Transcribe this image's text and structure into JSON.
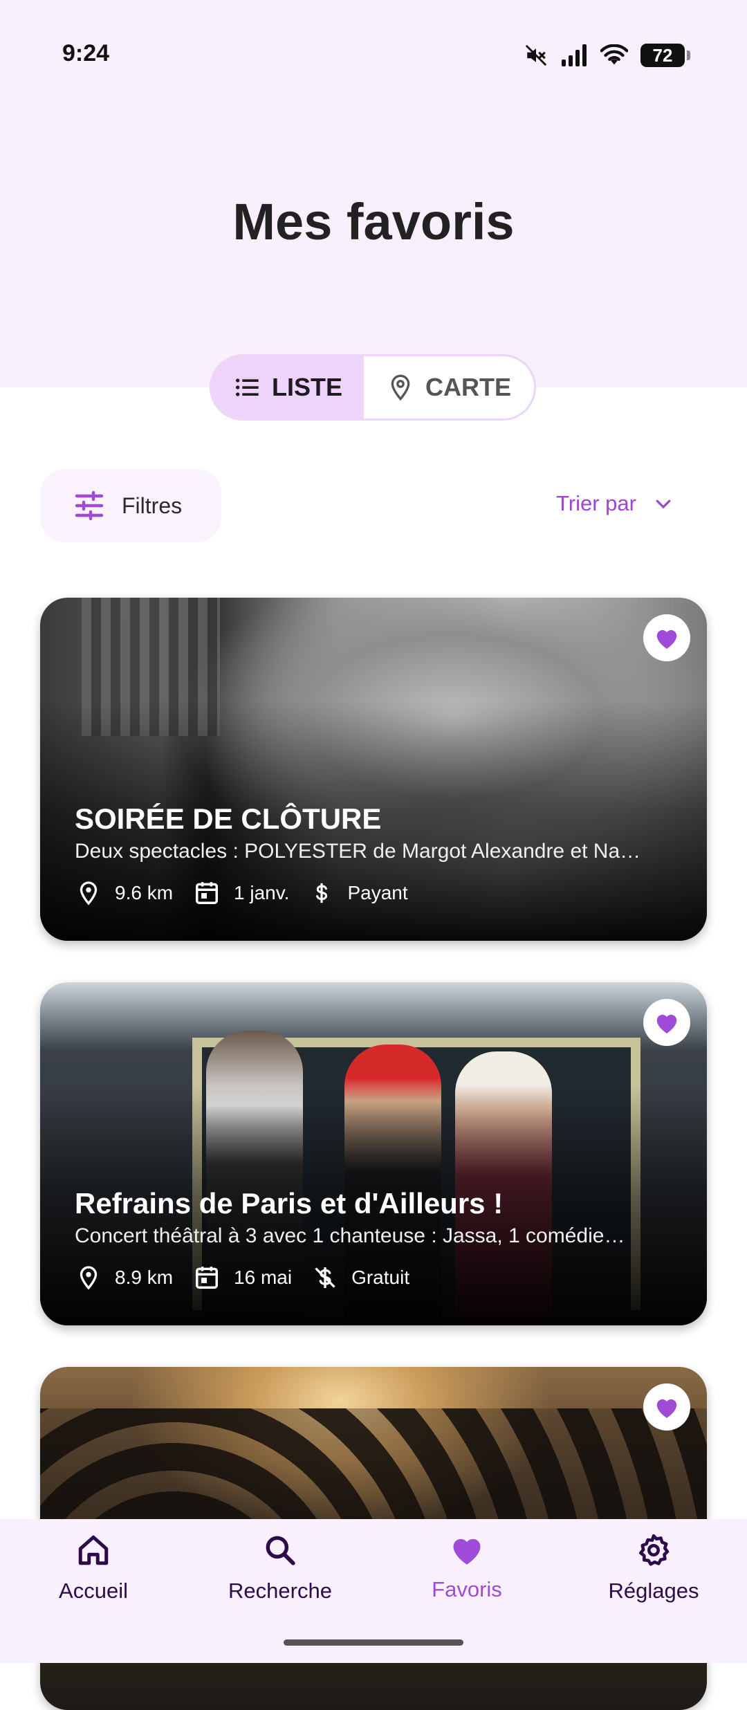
{
  "status_bar": {
    "time": "9:24",
    "battery": "72"
  },
  "header": {
    "title": "Mes favoris"
  },
  "view_toggle": {
    "list_label": "LISTE",
    "map_label": "CARTE",
    "active": "list"
  },
  "toolbar": {
    "filters_label": "Filtres",
    "sort_label": "Trier par"
  },
  "events": [
    {
      "title": "SOIRÉE DE CLÔTURE",
      "description": "Deux spectacles : POLYESTER de Margot Alexandre et Na…",
      "distance": "9.6 km",
      "date": "1 janv.",
      "price": "Payant",
      "price_icon": "paid-icon",
      "favorited": true
    },
    {
      "title": "Refrains de Paris et d'Ailleurs !",
      "description": "Concert théâtral à 3 avec 1 chanteuse : Jassa, 1 comédie…",
      "distance": "8.9 km",
      "date": "16 mai",
      "price": "Gratuit",
      "price_icon": "free-icon",
      "favorited": true
    },
    {
      "favorited": true
    }
  ],
  "bottom_nav": {
    "items": [
      {
        "label": "Accueil",
        "icon": "home-icon"
      },
      {
        "label": "Recherche",
        "icon": "search-icon"
      },
      {
        "label": "Favoris",
        "icon": "heart-icon",
        "active": true
      },
      {
        "label": "Réglages",
        "icon": "gear-icon"
      }
    ]
  },
  "colors": {
    "accent": "#9b45d1",
    "header_bg": "#f8f0fc",
    "toggle_active": "#eed3fa"
  }
}
